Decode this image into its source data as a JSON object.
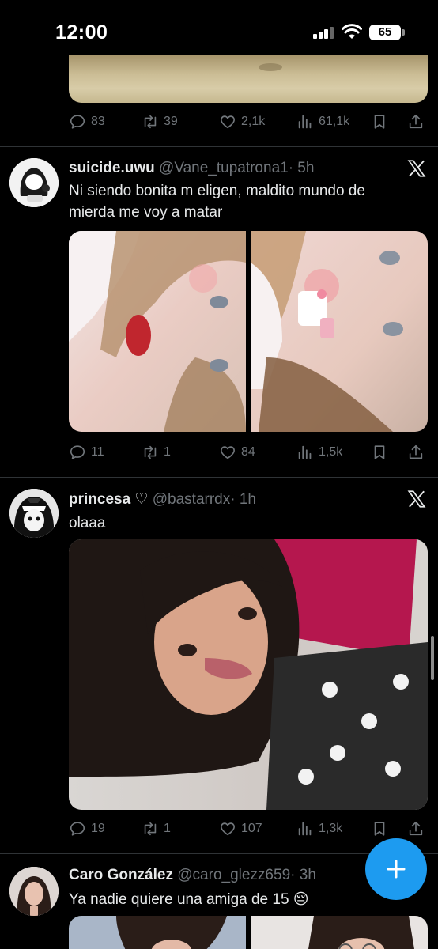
{
  "status_bar": {
    "time": "12:00",
    "battery": "65"
  },
  "tweets_prev": {
    "replies": "83",
    "retweets": "39",
    "likes": "2,1k",
    "views": "61,1k"
  },
  "tweets": [
    {
      "name": "suicide.uwu",
      "handle": "@Vane_tupatrona1",
      "time": "· 5h",
      "text_line1": "Ni siendo bonita m eligen, maldito mundo de",
      "text_line2": "mierda me voy a matar",
      "replies": "11",
      "retweets": "1",
      "likes": "84",
      "views": "1,5k"
    },
    {
      "name": "princesa ♡",
      "handle": "@bastarrdx",
      "time": "· 1h",
      "text": "olaaa",
      "replies": "19",
      "retweets": "1",
      "likes": "107",
      "views": "1,3k"
    },
    {
      "name": "Caro González",
      "handle": "@caro_glezz659",
      "time": "· 3h",
      "text": "Ya nadie quiere una amiga de 15 😔"
    }
  ],
  "colors": {
    "accent": "#1d9bf0",
    "muted": "#71767b",
    "text": "#e7e9ea",
    "background": "#000000"
  },
  "icons": [
    "reply-icon",
    "retweet-icon",
    "like-icon",
    "views-icon",
    "bookmark-icon",
    "share-icon",
    "x-logo-icon",
    "compose-plus-icon"
  ]
}
